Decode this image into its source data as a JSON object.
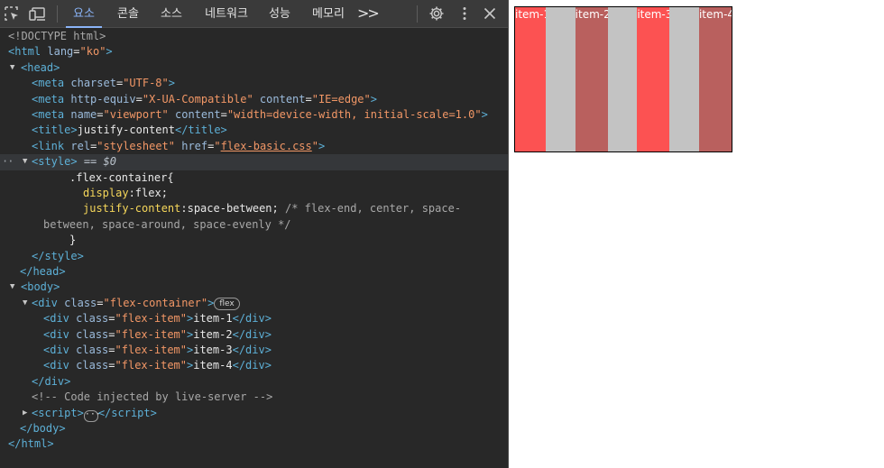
{
  "devtools": {
    "tabs": [
      {
        "label": "요소",
        "active": true
      },
      {
        "label": "콘솔"
      },
      {
        "label": "소스"
      },
      {
        "label": "네트워크"
      },
      {
        "label": "성능"
      },
      {
        "label": "메모리"
      }
    ],
    "more_tabs": ">>",
    "icons": [
      "inspect-element-icon",
      "device-toolbar-icon",
      "settings-gear-icon",
      "more-options-icon",
      "close-icon"
    ],
    "code": {
      "doctype": "<!DOCTYPE html>",
      "html_open": {
        "tag": "html",
        "attr": "lang",
        "val": "\"ko\""
      },
      "head_tag": "head",
      "meta_charset": {
        "tag": "meta",
        "attr": "charset",
        "val": "\"UTF-8\""
      },
      "meta_compat": {
        "tag": "meta",
        "attr1": "http-equiv",
        "val1": "\"X-UA-Compatible\"",
        "attr2": "content",
        "val2": "\"IE=edge\""
      },
      "meta_viewport": {
        "tag": "meta",
        "attr1": "name",
        "val1": "\"viewport\"",
        "attr2": "content",
        "val2": "\"width=device-width, initial-scale=1.0\""
      },
      "title": {
        "tag": "title",
        "text": "justify-content"
      },
      "link": {
        "tag": "link",
        "attr1": "rel",
        "val1": "\"stylesheet\"",
        "attr2": "href",
        "val2": "flex-basic.css"
      },
      "style_tag": "style",
      "style_eq": "== $0",
      "css_selector": ".flex-container{",
      "css_display_prop": "display",
      "css_display_val": ":flex;",
      "css_jc_prop": "justify-content",
      "css_jc_val": ":space-between;",
      "css_comment_1": "/* flex-end, center, space-",
      "css_comment_2": "between, space-around, space-evenly */",
      "css_close": "}",
      "style_close": "style",
      "head_close": "head",
      "body_tag": "body",
      "div_container": {
        "tag": "div",
        "attr": "class",
        "val": "\"flex-container\"",
        "badge": "flex"
      },
      "items": [
        {
          "tag": "div",
          "attr": "class",
          "val": "\"flex-item\"",
          "text": "item-1"
        },
        {
          "tag": "div",
          "attr": "class",
          "val": "\"flex-item\"",
          "text": "item-2"
        },
        {
          "tag": "div",
          "attr": "class",
          "val": "\"flex-item\"",
          "text": "item-3"
        },
        {
          "tag": "div",
          "attr": "class",
          "val": "\"flex-item\"",
          "text": "item-4"
        }
      ],
      "div_close": "div",
      "injected_comment": "<!-- Code injected by live-server -->",
      "script_tag": "script",
      "script_ellipsis": "···",
      "body_close": "body",
      "html_close": "html"
    }
  },
  "preview": {
    "items": [
      {
        "label": "item-1",
        "color": "#fc5252"
      },
      {
        "label": "item-2",
        "color": "#b9605e"
      },
      {
        "label": "item-3",
        "color": "#fc5252"
      },
      {
        "label": "item-4",
        "color": "#b9605e"
      }
    ],
    "container_bg": "#c3c3c3"
  }
}
